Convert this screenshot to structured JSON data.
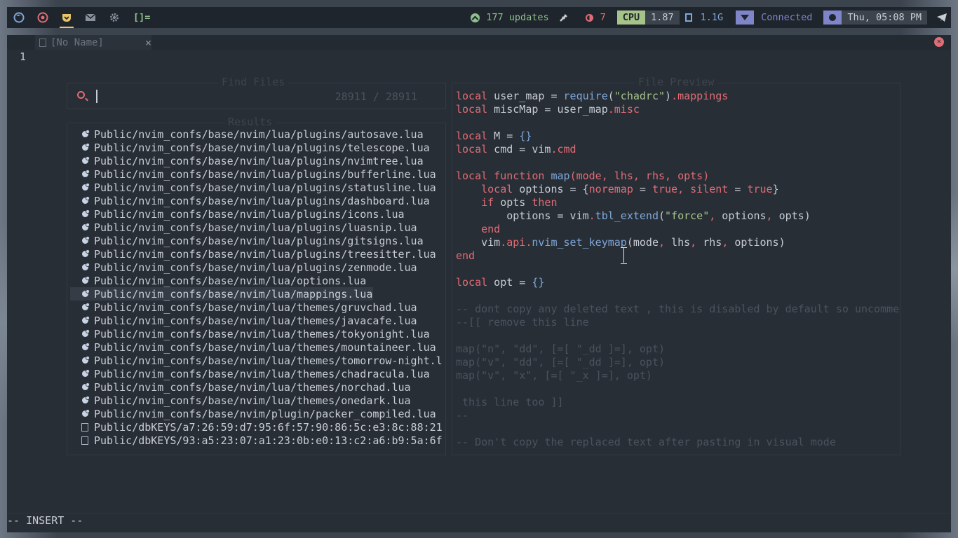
{
  "topbar": {
    "layout": "[]=",
    "updates": "177 updates",
    "temp_value": "7",
    "cpu_label": "CPU",
    "cpu_value": "1.87",
    "mem_value": "1.1G",
    "network": "Connected",
    "clock": "Thu, 05:08 PM",
    "colors": {
      "green": "#8fbf8f",
      "red": "#e06c75",
      "blue": "#7fa7d8",
      "purple": "#7f85c9"
    }
  },
  "editor": {
    "tab_name": "[No Name]",
    "tab_close": "×",
    "line_number": "1",
    "mode": "-- INSERT --"
  },
  "telescope": {
    "prompt_title": "Find Files",
    "results_title": "Results",
    "preview_title": "File Preview",
    "count": "28911 / 28911",
    "selected_index": 12,
    "results": [
      "Public/nvim_confs/base/nvim/lua/plugins/autosave.lua",
      "Public/nvim_confs/base/nvim/lua/plugins/telescope.lua",
      "Public/nvim_confs/base/nvim/lua/plugins/nvimtree.lua",
      "Public/nvim_confs/base/nvim/lua/plugins/bufferline.lua",
      "Public/nvim_confs/base/nvim/lua/plugins/statusline.lua",
      "Public/nvim_confs/base/nvim/lua/plugins/dashboard.lua",
      "Public/nvim_confs/base/nvim/lua/plugins/icons.lua",
      "Public/nvim_confs/base/nvim/lua/plugins/luasnip.lua",
      "Public/nvim_confs/base/nvim/lua/plugins/gitsigns.lua",
      "Public/nvim_confs/base/nvim/lua/plugins/treesitter.lua",
      "Public/nvim_confs/base/nvim/lua/plugins/zenmode.lua",
      "Public/nvim_confs/base/nvim/lua/options.lua",
      "Public/nvim_confs/base/nvim/lua/mappings.lua",
      "Public/nvim_confs/base/nvim/lua/themes/gruvchad.lua",
      "Public/nvim_confs/base/nvim/lua/themes/javacafe.lua",
      "Public/nvim_confs/base/nvim/lua/themes/tokyonight.lua",
      "Public/nvim_confs/base/nvim/lua/themes/mountaineer.lua",
      "Public/nvim_confs/base/nvim/lua/themes/tomorrow-night.l",
      "Public/nvim_confs/base/nvim/lua/themes/chadracula.lua",
      "Public/nvim_confs/base/nvim/lua/themes/norchad.lua",
      "Public/nvim_confs/base/nvim/lua/themes/onedark.lua",
      "Public/nvim_confs/base/nvim/plugin/packer_compiled.lua",
      "Public/dbKEYS/a7:26:59:d7:95:6f:57:90:86:5c:e3:8c:88:21",
      "Public/dbKEYS/93:a5:23:07:a1:23:0b:e0:13:c2:a6:b9:5a:6f"
    ],
    "result_icons": [
      "lua",
      "lua",
      "lua",
      "lua",
      "lua",
      "lua",
      "lua",
      "lua",
      "lua",
      "lua",
      "lua",
      "lua",
      "lua",
      "lua",
      "lua",
      "lua",
      "lua",
      "lua",
      "lua",
      "lua",
      "lua",
      "lua",
      "doc",
      "doc"
    ],
    "preview_lines": [
      [
        [
          "kw",
          "local"
        ],
        [
          "id",
          " user_map = "
        ],
        [
          "fn",
          "require"
        ],
        [
          "id",
          "("
        ],
        [
          "str",
          "\"chadrc\""
        ],
        [
          "id",
          ")"
        ],
        [
          "kw",
          ".mappings"
        ]
      ],
      [
        [
          "kw",
          "local"
        ],
        [
          "id",
          " miscMap = user_map"
        ],
        [
          "kw",
          ".misc"
        ]
      ],
      [],
      [
        [
          "kw",
          "local"
        ],
        [
          "id",
          " M = "
        ],
        [
          "fn",
          "{}"
        ]
      ],
      [
        [
          "kw",
          "local"
        ],
        [
          "id",
          " cmd = vim"
        ],
        [
          "kw",
          ".cmd"
        ]
      ],
      [],
      [
        [
          "kw",
          "local"
        ],
        [
          "id",
          " "
        ],
        [
          "kw",
          "function"
        ],
        [
          "id",
          " "
        ],
        [
          "fn",
          "map"
        ],
        [
          "kw",
          "(mode, lhs, rhs, opts)"
        ]
      ],
      [
        [
          "id",
          "    "
        ],
        [
          "kw",
          "local"
        ],
        [
          "id",
          " options = {"
        ],
        [
          "kw",
          "noremap"
        ],
        [
          "id",
          " = "
        ],
        [
          "bool",
          "true"
        ],
        [
          "kw",
          ", silent"
        ],
        [
          "id",
          " = "
        ],
        [
          "bool",
          "true"
        ],
        [
          "id",
          "}"
        ]
      ],
      [
        [
          "id",
          "    "
        ],
        [
          "kw",
          "if"
        ],
        [
          "id",
          " opts "
        ],
        [
          "kw",
          "then"
        ]
      ],
      [
        [
          "id",
          "        options = vim"
        ],
        [
          "kw",
          "."
        ],
        [
          "fn",
          "tbl_extend"
        ],
        [
          "id",
          "("
        ],
        [
          "str",
          "\"force\""
        ],
        [
          "kw",
          ","
        ],
        [
          "id",
          " options"
        ],
        [
          "kw",
          ","
        ],
        [
          "id",
          " opts)"
        ]
      ],
      [
        [
          "id",
          "    "
        ],
        [
          "kw",
          "end"
        ]
      ],
      [
        [
          "id",
          "    vim"
        ],
        [
          "kw",
          ".api."
        ],
        [
          "fn",
          "nvim_set_keymap"
        ],
        [
          "id",
          "(mode"
        ],
        [
          "kw",
          ","
        ],
        [
          "id",
          " lhs"
        ],
        [
          "kw",
          ","
        ],
        [
          "id",
          " rhs"
        ],
        [
          "kw",
          ","
        ],
        [
          "id",
          " options)"
        ]
      ],
      [
        [
          "kw",
          "end"
        ]
      ],
      [],
      [
        [
          "kw",
          "local"
        ],
        [
          "id",
          " opt = "
        ],
        [
          "fn",
          "{}"
        ]
      ],
      [],
      [
        [
          "cmt",
          "-- dont copy any deleted text , this is disabled by default so uncomme"
        ]
      ],
      [
        [
          "cmt",
          "--[[ remove this line"
        ]
      ],
      [],
      [
        [
          "cmt",
          "map(\"n\", \"dd\", [=[ \"_dd ]=], opt)"
        ]
      ],
      [
        [
          "cmt",
          "map(\"v\", \"dd\", [=[ \"_dd ]=], opt)"
        ]
      ],
      [
        [
          "cmt",
          "map(\"v\", \"x\", [=[ \"_x ]=], opt)"
        ]
      ],
      [],
      [
        [
          "cmt",
          " this line too ]]"
        ]
      ],
      [
        [
          "cmt",
          "--"
        ]
      ],
      [],
      [
        [
          "cmt",
          "-- Don't copy the replaced text after pasting in visual mode"
        ]
      ]
    ]
  }
}
